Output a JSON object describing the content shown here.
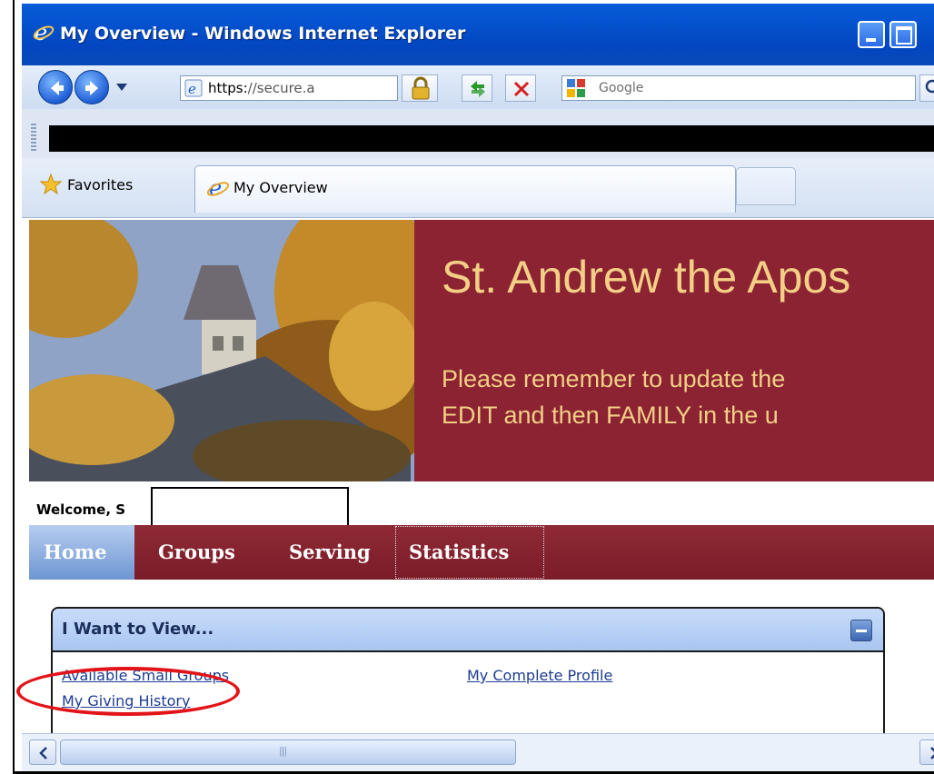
{
  "window": {
    "title": "My Overview - Windows Internet Explorer"
  },
  "address_bar": {
    "url_scheme": "https:",
    "url_rest": "//secure.a",
    "search_placeholder": "Google"
  },
  "favorites_bar": {
    "favorites_label": "Favorites",
    "tab_label": "My Overview"
  },
  "banner": {
    "headline": "St. Andrew the Apos",
    "message_line1": "Please remember to update the",
    "message_line2": "EDIT and then FAMILY in the u"
  },
  "welcome": {
    "text": "Welcome, S"
  },
  "nav": {
    "items": [
      "Home",
      "Groups",
      "Serving",
      "Statistics"
    ],
    "active": "Home"
  },
  "panel": {
    "title": "I Want to View...",
    "links": [
      "Available Small Groups",
      "My Complete Profile",
      "My Giving History"
    ],
    "highlighted_link": "My Giving History"
  },
  "colors": {
    "banner_bg": "#8c2332",
    "banner_text": "#f3cf86",
    "highlight_circle": "#e2141a",
    "titlebar": "#0453d0"
  },
  "icons": [
    "ie-logo-icon",
    "back-arrow-icon",
    "forward-arrow-icon",
    "lock-icon",
    "refresh-icon",
    "stop-icon",
    "google-icon",
    "search-icon",
    "favorites-star-icon",
    "collapse-icon"
  ]
}
